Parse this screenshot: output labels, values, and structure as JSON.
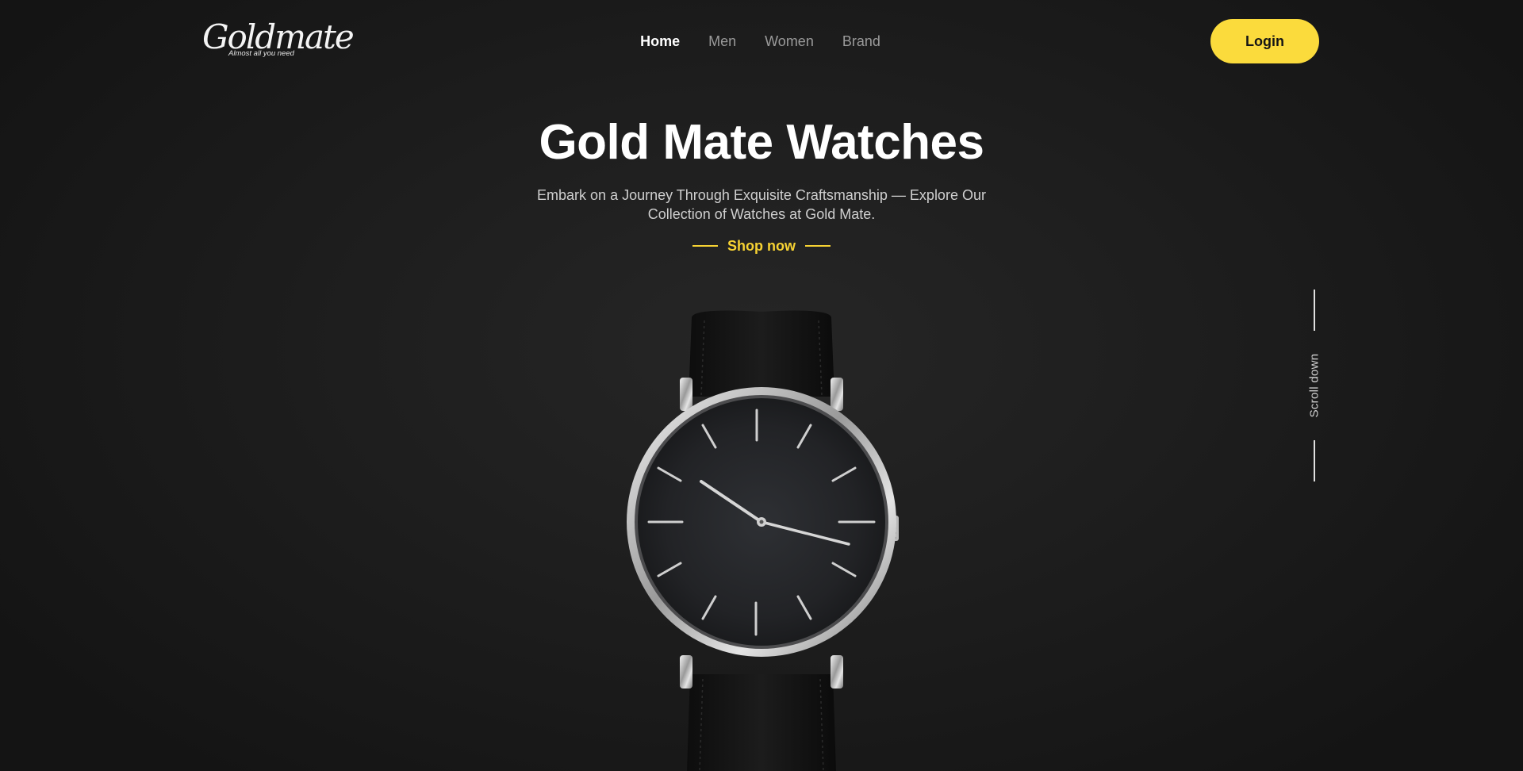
{
  "brand": {
    "logo_text": "Goldmate",
    "tagline": "Almost all you need"
  },
  "nav": {
    "items": [
      {
        "label": "Home",
        "active": true
      },
      {
        "label": "Men",
        "active": false
      },
      {
        "label": "Women",
        "active": false
      },
      {
        "label": "Brand",
        "active": false
      }
    ]
  },
  "header": {
    "login_label": "Login"
  },
  "hero": {
    "title": "Gold Mate Watches",
    "subtitle": "Embark on a Journey Through Exquisite Craftsmanship — Explore Our Collection of Watches at Gold Mate.",
    "cta_label": "Shop now"
  },
  "scroll": {
    "label": "Scroll down"
  },
  "colors": {
    "accent": "#fbdb3c",
    "background": "#1b1b1b",
    "text": "#ffffff",
    "muted": "#9a9a9a"
  },
  "image": {
    "subject": "watch-icon"
  }
}
